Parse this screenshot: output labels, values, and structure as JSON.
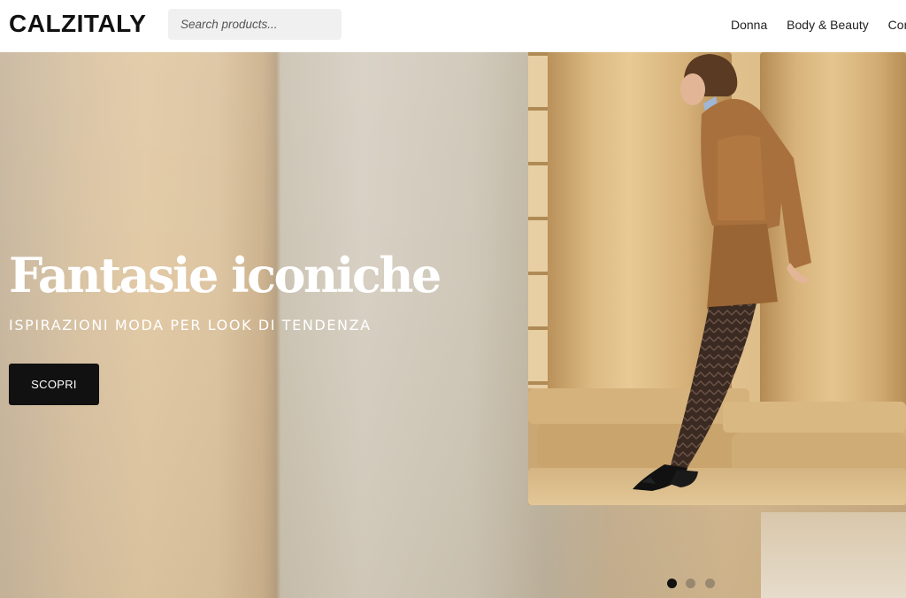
{
  "header": {
    "logo": "CALZITALY",
    "search": {
      "placeholder": "Search products...",
      "value": ""
    },
    "nav": [
      {
        "label": "Donna"
      },
      {
        "label": "Body & Beauty"
      },
      {
        "label": "Cor"
      }
    ]
  },
  "hero": {
    "title": "Fantasie iconiche",
    "subtitle": "ISPIRAZIONI MODA PER LOOK DI TENDENZA",
    "cta_label": "SCOPRI",
    "slides": {
      "total": 3,
      "active": 1
    }
  },
  "colors": {
    "accent": "#111111",
    "text_on_hero": "#ffffff",
    "search_bg": "#f0f0f0"
  },
  "icons": [
    "carousel-dot"
  ]
}
